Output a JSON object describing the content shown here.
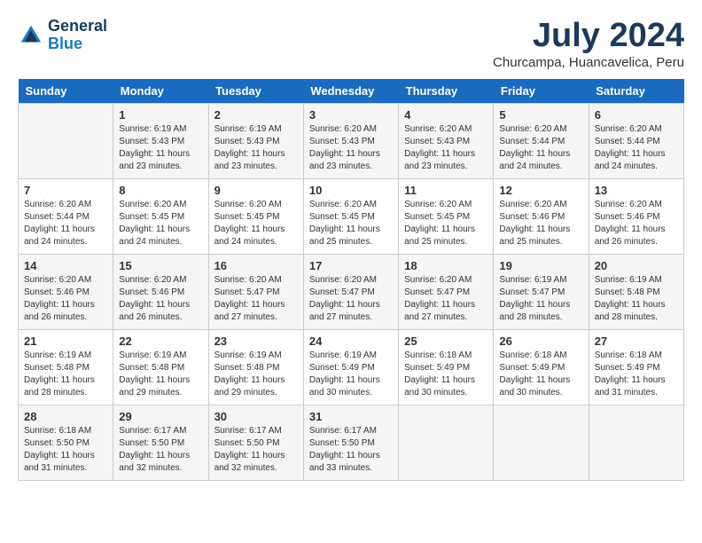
{
  "logo": {
    "line1": "General",
    "line2": "Blue"
  },
  "title": "July 2024",
  "location": "Churcampa, Huancavelica, Peru",
  "weekdays": [
    "Sunday",
    "Monday",
    "Tuesday",
    "Wednesday",
    "Thursday",
    "Friday",
    "Saturday"
  ],
  "weeks": [
    [
      {
        "num": "",
        "detail": ""
      },
      {
        "num": "1",
        "detail": "Sunrise: 6:19 AM\nSunset: 5:43 PM\nDaylight: 11 hours\nand 23 minutes."
      },
      {
        "num": "2",
        "detail": "Sunrise: 6:19 AM\nSunset: 5:43 PM\nDaylight: 11 hours\nand 23 minutes."
      },
      {
        "num": "3",
        "detail": "Sunrise: 6:20 AM\nSunset: 5:43 PM\nDaylight: 11 hours\nand 23 minutes."
      },
      {
        "num": "4",
        "detail": "Sunrise: 6:20 AM\nSunset: 5:43 PM\nDaylight: 11 hours\nand 23 minutes."
      },
      {
        "num": "5",
        "detail": "Sunrise: 6:20 AM\nSunset: 5:44 PM\nDaylight: 11 hours\nand 24 minutes."
      },
      {
        "num": "6",
        "detail": "Sunrise: 6:20 AM\nSunset: 5:44 PM\nDaylight: 11 hours\nand 24 minutes."
      }
    ],
    [
      {
        "num": "7",
        "detail": "Sunrise: 6:20 AM\nSunset: 5:44 PM\nDaylight: 11 hours\nand 24 minutes."
      },
      {
        "num": "8",
        "detail": "Sunrise: 6:20 AM\nSunset: 5:45 PM\nDaylight: 11 hours\nand 24 minutes."
      },
      {
        "num": "9",
        "detail": "Sunrise: 6:20 AM\nSunset: 5:45 PM\nDaylight: 11 hours\nand 24 minutes."
      },
      {
        "num": "10",
        "detail": "Sunrise: 6:20 AM\nSunset: 5:45 PM\nDaylight: 11 hours\nand 25 minutes."
      },
      {
        "num": "11",
        "detail": "Sunrise: 6:20 AM\nSunset: 5:45 PM\nDaylight: 11 hours\nand 25 minutes."
      },
      {
        "num": "12",
        "detail": "Sunrise: 6:20 AM\nSunset: 5:46 PM\nDaylight: 11 hours\nand 25 minutes."
      },
      {
        "num": "13",
        "detail": "Sunrise: 6:20 AM\nSunset: 5:46 PM\nDaylight: 11 hours\nand 26 minutes."
      }
    ],
    [
      {
        "num": "14",
        "detail": "Sunrise: 6:20 AM\nSunset: 5:46 PM\nDaylight: 11 hours\nand 26 minutes."
      },
      {
        "num": "15",
        "detail": "Sunrise: 6:20 AM\nSunset: 5:46 PM\nDaylight: 11 hours\nand 26 minutes."
      },
      {
        "num": "16",
        "detail": "Sunrise: 6:20 AM\nSunset: 5:47 PM\nDaylight: 11 hours\nand 27 minutes."
      },
      {
        "num": "17",
        "detail": "Sunrise: 6:20 AM\nSunset: 5:47 PM\nDaylight: 11 hours\nand 27 minutes."
      },
      {
        "num": "18",
        "detail": "Sunrise: 6:20 AM\nSunset: 5:47 PM\nDaylight: 11 hours\nand 27 minutes."
      },
      {
        "num": "19",
        "detail": "Sunrise: 6:19 AM\nSunset: 5:47 PM\nDaylight: 11 hours\nand 28 minutes."
      },
      {
        "num": "20",
        "detail": "Sunrise: 6:19 AM\nSunset: 5:48 PM\nDaylight: 11 hours\nand 28 minutes."
      }
    ],
    [
      {
        "num": "21",
        "detail": "Sunrise: 6:19 AM\nSunset: 5:48 PM\nDaylight: 11 hours\nand 28 minutes."
      },
      {
        "num": "22",
        "detail": "Sunrise: 6:19 AM\nSunset: 5:48 PM\nDaylight: 11 hours\nand 29 minutes."
      },
      {
        "num": "23",
        "detail": "Sunrise: 6:19 AM\nSunset: 5:48 PM\nDaylight: 11 hours\nand 29 minutes."
      },
      {
        "num": "24",
        "detail": "Sunrise: 6:19 AM\nSunset: 5:49 PM\nDaylight: 11 hours\nand 30 minutes."
      },
      {
        "num": "25",
        "detail": "Sunrise: 6:18 AM\nSunset: 5:49 PM\nDaylight: 11 hours\nand 30 minutes."
      },
      {
        "num": "26",
        "detail": "Sunrise: 6:18 AM\nSunset: 5:49 PM\nDaylight: 11 hours\nand 30 minutes."
      },
      {
        "num": "27",
        "detail": "Sunrise: 6:18 AM\nSunset: 5:49 PM\nDaylight: 11 hours\nand 31 minutes."
      }
    ],
    [
      {
        "num": "28",
        "detail": "Sunrise: 6:18 AM\nSunset: 5:50 PM\nDaylight: 11 hours\nand 31 minutes."
      },
      {
        "num": "29",
        "detail": "Sunrise: 6:17 AM\nSunset: 5:50 PM\nDaylight: 11 hours\nand 32 minutes."
      },
      {
        "num": "30",
        "detail": "Sunrise: 6:17 AM\nSunset: 5:50 PM\nDaylight: 11 hours\nand 32 minutes."
      },
      {
        "num": "31",
        "detail": "Sunrise: 6:17 AM\nSunset: 5:50 PM\nDaylight: 11 hours\nand 33 minutes."
      },
      {
        "num": "",
        "detail": ""
      },
      {
        "num": "",
        "detail": ""
      },
      {
        "num": "",
        "detail": ""
      }
    ]
  ]
}
